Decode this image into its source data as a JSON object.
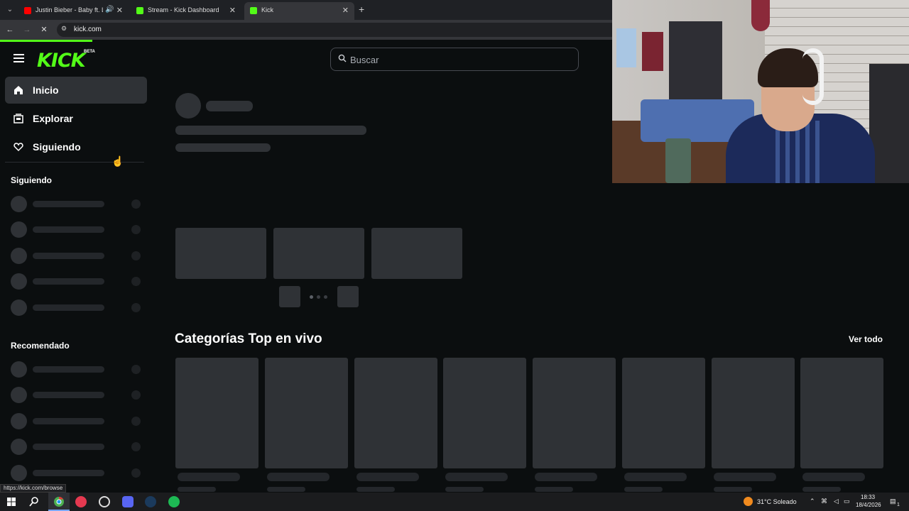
{
  "browser": {
    "tabs": [
      {
        "title": "Justin Bieber - Baby ft. Ludacris",
        "active": false
      },
      {
        "title": "Stream - Kick Dashboard",
        "active": false
      },
      {
        "title": "Kick",
        "active": true
      }
    ],
    "new_tab": "+",
    "url": "kick.com",
    "status_url": "https://kick.com/browse"
  },
  "header": {
    "logo": "KICK",
    "logo_badge": "BETA",
    "search_placeholder": "Buscar"
  },
  "sidebar": {
    "nav": [
      {
        "label": "Inicio",
        "icon": "home-icon",
        "active": true
      },
      {
        "label": "Explorar",
        "icon": "browse-icon",
        "active": false
      },
      {
        "label": "Siguiendo",
        "icon": "heart-icon",
        "active": false
      }
    ],
    "sections": [
      {
        "title": "Siguiendo"
      },
      {
        "title": "Recomendado"
      }
    ]
  },
  "main": {
    "categories_title": "Categorías Top en vivo",
    "see_all": "Ver todo"
  },
  "taskbar": {
    "weather": "31°C Soleado",
    "time": "18:33",
    "date": "18/4/2026",
    "notification_count": "1"
  },
  "colors": {
    "brand": "#53fc18",
    "background": "#0b0e0f",
    "skeleton": "#2f3236"
  }
}
